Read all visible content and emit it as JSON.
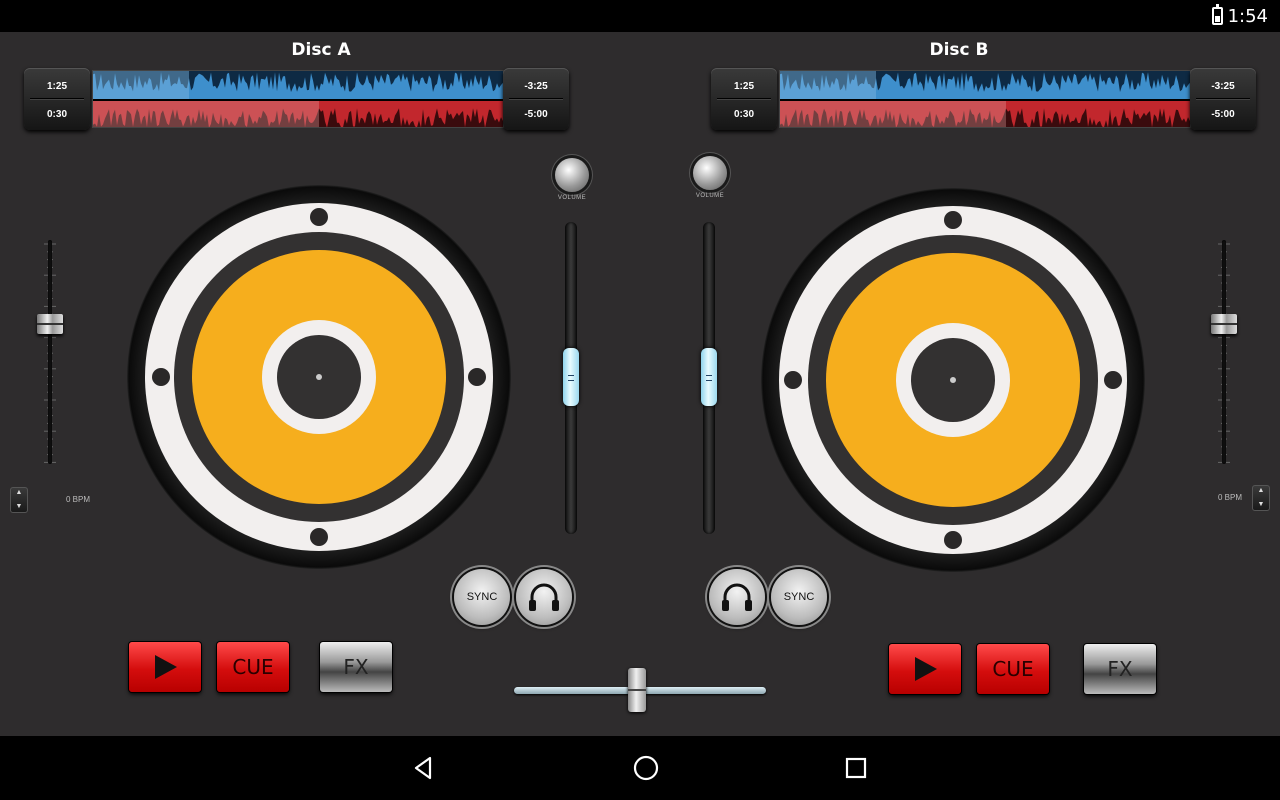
{
  "status_bar": {
    "time": "1:54",
    "battery_icon": "battery-charging-icon"
  },
  "deck_a": {
    "title": "Disc A",
    "elapsed_top": "1:25",
    "elapsed_bottom": "0:30",
    "remaining_top": "-3:25",
    "remaining_bottom": "-5:00",
    "bpm": "0 BPM",
    "volume_label": "VOLUME",
    "sync_label": "SYNC",
    "play_icon": "play-icon",
    "cue_label": "CUE",
    "fx_label": "FX",
    "headphones_icon": "headphones-icon"
  },
  "deck_b": {
    "title": "Disc B",
    "elapsed_top": "1:25",
    "elapsed_bottom": "0:30",
    "remaining_top": "-3:25",
    "remaining_bottom": "-5:00",
    "bpm": "0 BPM",
    "volume_label": "VOLUME",
    "sync_label": "SYNC",
    "play_icon": "play-icon",
    "cue_label": "CUE",
    "fx_label": "FX",
    "headphones_icon": "headphones-icon"
  },
  "colors": {
    "platter": "#f6ae1d",
    "waveform_top": "#3e8fcc",
    "waveform_bottom": "#c2272d",
    "button_red": "#e01414",
    "fader_cyan": "#bfeefe"
  },
  "nav_bar": {
    "back_icon": "back-triangle-icon",
    "home_icon": "home-circle-icon",
    "recents_icon": "recents-square-icon"
  }
}
